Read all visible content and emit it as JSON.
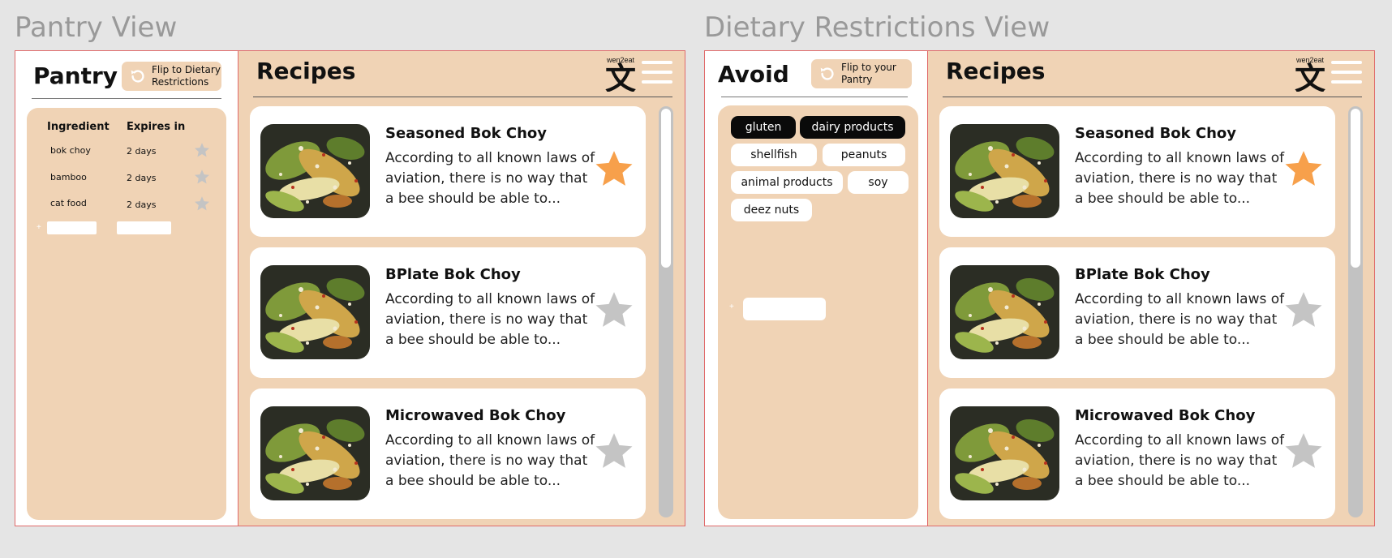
{
  "views": {
    "pantry_label": "Pantry View",
    "dietary_label": "Dietary Restrictions View"
  },
  "pantry": {
    "title": "Pantry",
    "flip_label": "Flip to Dietary Restrictions",
    "columns": [
      "Ingredient",
      "Expires in"
    ],
    "items": [
      {
        "ingredient": "bok choy",
        "expires": "2 days"
      },
      {
        "ingredient": "bamboo",
        "expires": "2 days"
      },
      {
        "ingredient": "cat food",
        "expires": "2 days"
      }
    ],
    "add_symbol": "+"
  },
  "avoid": {
    "title": "Avoid",
    "flip_label": "Flip to your Pantry",
    "tags": [
      {
        "label": "gluten",
        "selected": true
      },
      {
        "label": "dairy products",
        "selected": true
      },
      {
        "label": "shellfish",
        "selected": false
      },
      {
        "label": "peanuts",
        "selected": false
      },
      {
        "label": "animal products",
        "selected": false
      },
      {
        "label": "soy",
        "selected": false
      },
      {
        "label": "deez nuts",
        "selected": false
      }
    ],
    "add_symbol": "+"
  },
  "recipes": {
    "title": "Recipes",
    "logo_text": "wen2eat",
    "logo_glyph": "文",
    "items": [
      {
        "name": "Seasoned Bok Choy",
        "description": "According to all known laws of aviation, there is no way that a bee should be able to...",
        "favorite": true
      },
      {
        "name": "BPlate Bok Choy",
        "description": "According to all known laws of aviation, there is no way that a bee should be able to...",
        "favorite": false
      },
      {
        "name": "Microwaved Bok Choy",
        "description": "According to all known laws of aviation, there is no way that a bee should be able to...",
        "favorite": false
      }
    ]
  },
  "icons": {
    "flip": "refresh-icon",
    "menu": "hamburger-menu-icon",
    "favorite": "star-icon"
  },
  "colors": {
    "background": "#e5e5e5",
    "panel_tan": "#f0d3b5",
    "favorite_on": "#f7a04b",
    "favorite_off": "#c4c4c4",
    "frame_border": "#e06a6a",
    "chip_selected": "#0a0a0a",
    "label_gray": "#999999"
  }
}
